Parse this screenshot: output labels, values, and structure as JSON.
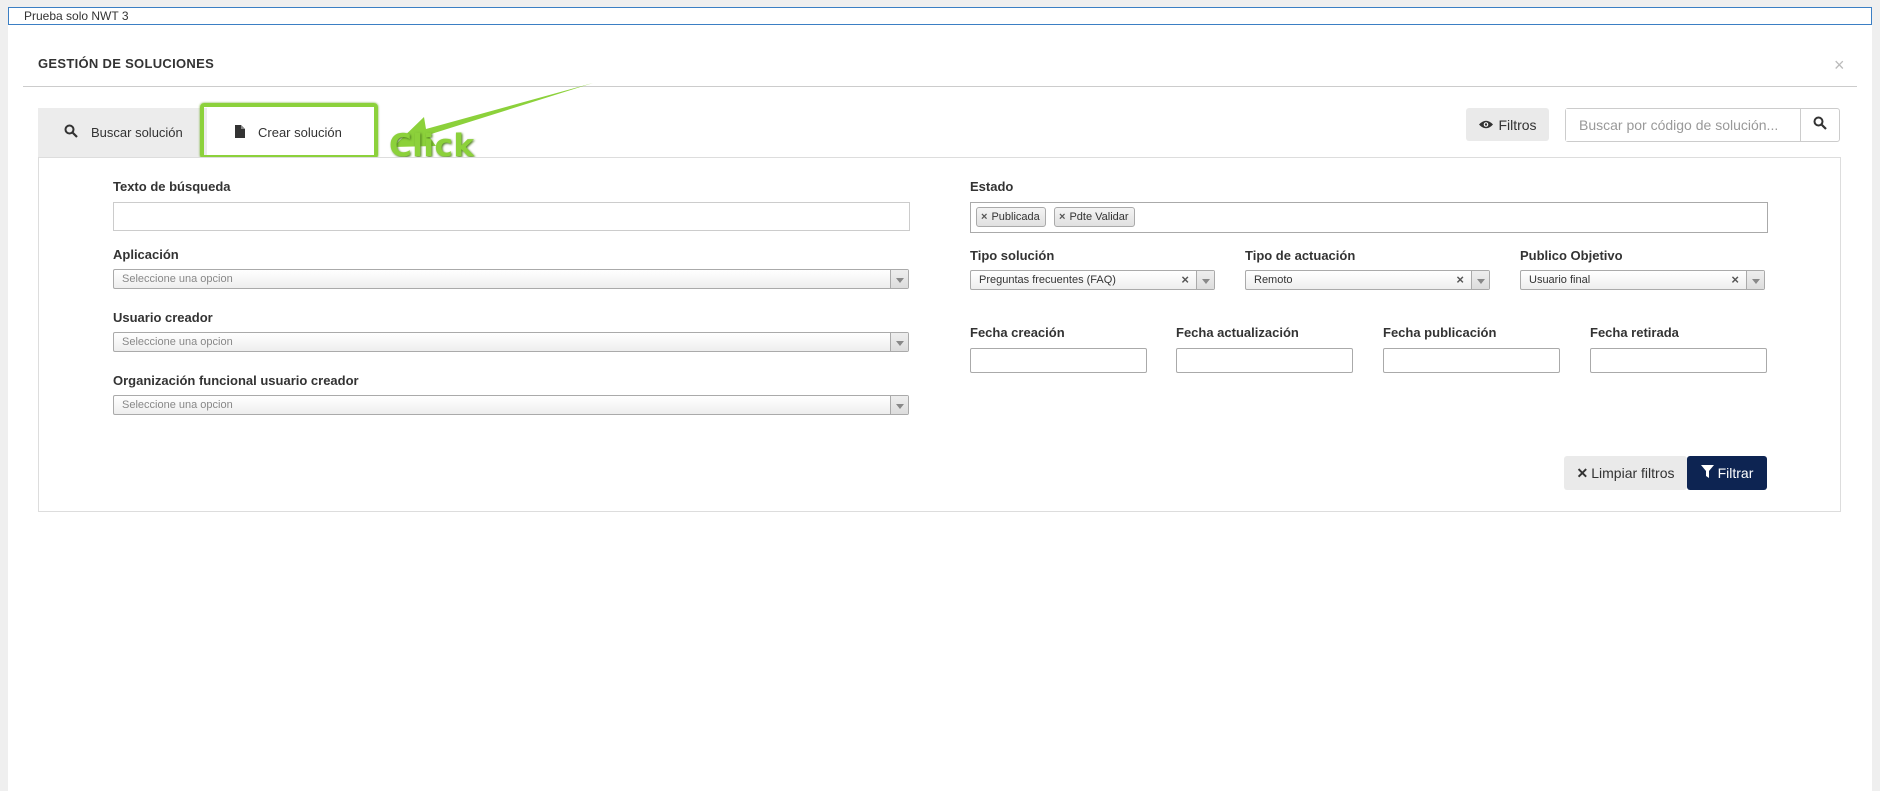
{
  "topbar": {
    "title": "Prueba solo NWT 3"
  },
  "panel": {
    "title": "GESTIÓN DE SOLUCIONES",
    "close": "×"
  },
  "tabs": [
    {
      "label": "Buscar solución",
      "icon": "search-icon"
    },
    {
      "label": "Crear solución",
      "icon": "document-icon"
    }
  ],
  "annotation": {
    "text": "Click",
    "color": "#8cd13b"
  },
  "toolbar": {
    "filtros_label": "Filtros",
    "search_placeholder": "Buscar por código de solución..."
  },
  "form": {
    "texto_busqueda_label": "Texto de búsqueda",
    "aplicacion_label": "Aplicación",
    "aplicacion_placeholder": "Seleccione una opcion",
    "usuario_creador_label": "Usuario creador",
    "usuario_creador_placeholder": "Seleccione una opcion",
    "org_funcional_label": "Organización funcional usuario creador",
    "org_funcional_placeholder": "Seleccione una opcion",
    "estado_label": "Estado",
    "estado_chips": [
      "Publicada",
      "Pdte Validar"
    ],
    "tipo_solucion_label": "Tipo solución",
    "tipo_solucion_value": "Preguntas frecuentes (FAQ)",
    "tipo_actuacion_label": "Tipo de actuación",
    "tipo_actuacion_value": "Remoto",
    "publico_objetivo_label": "Publico Objetivo",
    "publico_objetivo_value": "Usuario final",
    "fecha_creacion_label": "Fecha creación",
    "fecha_actualizacion_label": "Fecha actualización",
    "fecha_publicacion_label": "Fecha publicación",
    "fecha_retirada_label": "Fecha retirada"
  },
  "actions": {
    "limpiar_label": "Limpiar filtros",
    "filtrar_label": "Filtrar"
  },
  "colors": {
    "primary": "#0d2452",
    "highlight": "#8cd13b",
    "topbar_border": "#3b7fc4"
  }
}
